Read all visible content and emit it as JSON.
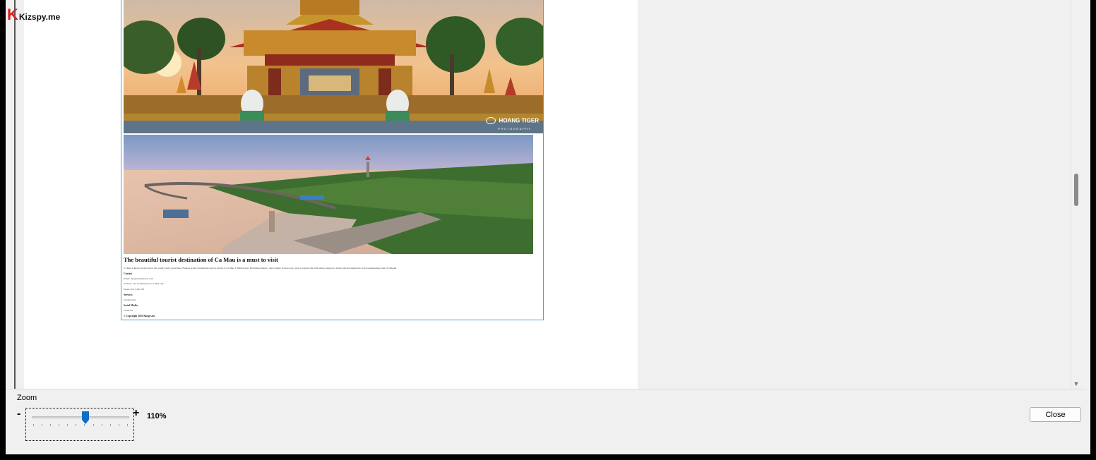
{
  "logo": {
    "brand_text": "Kizspy.me",
    "letter": "K"
  },
  "document": {
    "image1_watermark": "HOANG TIGER",
    "image1_watermark_sub": "PHOTOGRAPHY",
    "article_title": "The beautiful tourist destination of Ca Mau is a must to visit",
    "article_body": "Ca Mau is known as the end of the country and a proud land. Famous scenic destinations such as the tip of Ca Mau, U Minh forest, Hon Khoai island... attract many visitors every year to explore the wild nature, mangrove forests and the unique life of the southernmost land of Vietnam.",
    "contact_heading": "Contact",
    "contact_email": "Email: info@camautravel.com",
    "contact_address": "Address: 123 Ca Mau Road, Ca Mau City",
    "contact_phone": "Phone: 0123 456 789",
    "services_heading": "Services",
    "services_item": "Guided tours",
    "social_heading": "Social Media",
    "social_item": "Facebook",
    "copyright": "© Copyright 2023 Kizspy.me"
  },
  "zoom": {
    "label": "Zoom",
    "minus": "-",
    "plus": "+",
    "value_text": "110%",
    "level_fraction": 0.55
  },
  "buttons": {
    "close": "Close"
  },
  "colors": {
    "accent": "#0b6fc9",
    "doc_border": "#4aa6d6",
    "logo_red": "#d9201f"
  }
}
